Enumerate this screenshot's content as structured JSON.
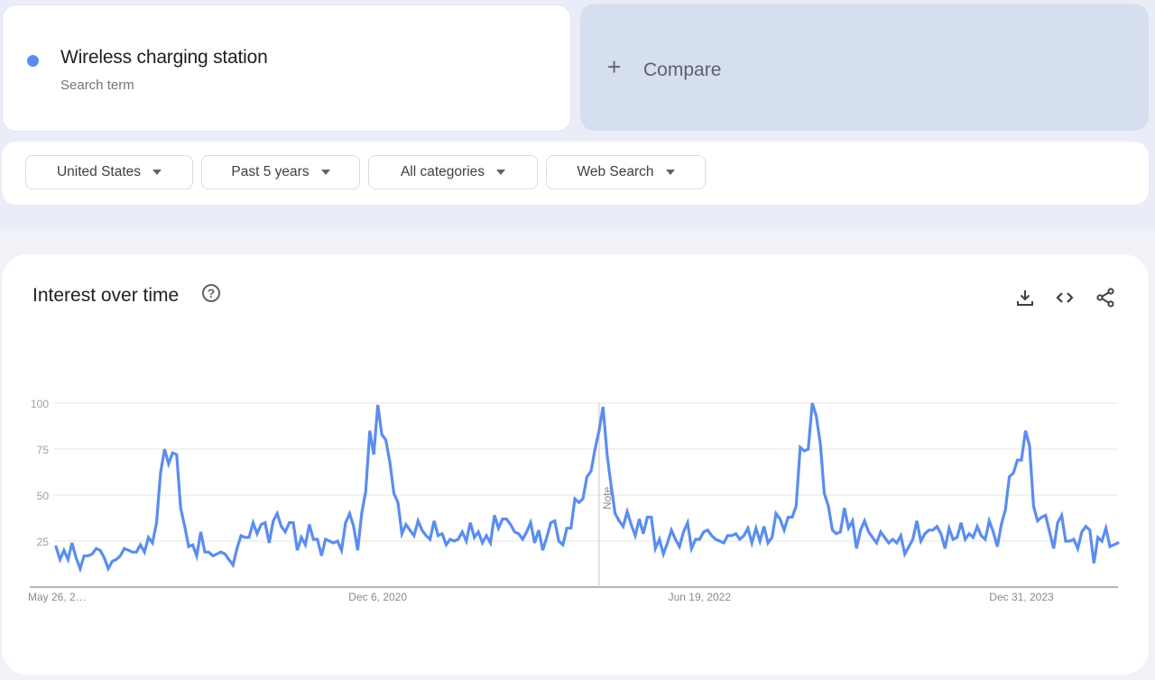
{
  "search_term": {
    "name": "Wireless charging station",
    "subtitle": "Search term",
    "color": "#5b8def"
  },
  "compare": {
    "icon": "plus-icon",
    "label": "Compare"
  },
  "filters": [
    {
      "label": "United States"
    },
    {
      "label": "Past 5 years"
    },
    {
      "label": "All categories"
    },
    {
      "label": "Web Search"
    }
  ],
  "chart_panel": {
    "title": "Interest over time",
    "help_icon": "help-circle-icon",
    "tools": [
      {
        "name": "download-icon",
        "glyph": "download"
      },
      {
        "name": "embed-icon",
        "glyph": "code"
      },
      {
        "name": "share-icon",
        "glyph": "share"
      }
    ],
    "note_label": "Note"
  },
  "chart_data": {
    "type": "line",
    "title": "Interest over time",
    "xlabel": "",
    "ylabel": "",
    "ylim": [
      0,
      100
    ],
    "yticks": [
      25,
      50,
      75,
      100
    ],
    "grid": true,
    "legend": "none",
    "x_tick_labels": [
      {
        "label": "May 26, 2…",
        "index": 0
      },
      {
        "label": "Dec 6, 2020",
        "index": 80
      },
      {
        "label": "Jun 19, 2022",
        "index": 160
      },
      {
        "label": "Dec 31, 2023",
        "index": 240
      }
    ],
    "note_index": 135,
    "series": [
      {
        "name": "Wireless charging station",
        "color": "#5b8def",
        "values": [
          22,
          15,
          20,
          15,
          24,
          16,
          10,
          17,
          17,
          18,
          21,
          20,
          16,
          10,
          14,
          15,
          17,
          21,
          20,
          19,
          19,
          23,
          19,
          27,
          24,
          35,
          62,
          75,
          67,
          73,
          72,
          43,
          33,
          22,
          23,
          17,
          30,
          19,
          19,
          17,
          18,
          19,
          18,
          15,
          12,
          21,
          28,
          27,
          27,
          35,
          29,
          34,
          35,
          24,
          36,
          40,
          33,
          30,
          35,
          35,
          20,
          27,
          23,
          34,
          26,
          26,
          17,
          26,
          25,
          24,
          25,
          20,
          35,
          40,
          33,
          20,
          40,
          52,
          85,
          72,
          99,
          83,
          80,
          68,
          51,
          46,
          29,
          34,
          31,
          28,
          36,
          31,
          28,
          26,
          36,
          28,
          29,
          23,
          26,
          25,
          26,
          30,
          25,
          35,
          27,
          30,
          24,
          28,
          24,
          39,
          32,
          37,
          37,
          34,
          30,
          29,
          26,
          30,
          35,
          24,
          31,
          20,
          27,
          35,
          36,
          25,
          23,
          32,
          32,
          48,
          46,
          48,
          60,
          63,
          75,
          85,
          98,
          72,
          55,
          40,
          36,
          33,
          41,
          34,
          28,
          37,
          29,
          38,
          38,
          21,
          26,
          18,
          24,
          31,
          26,
          22,
          30,
          35,
          21,
          26,
          26,
          30,
          31,
          28,
          26,
          25,
          24,
          28,
          28,
          29,
          26,
          28,
          32,
          24,
          32,
          25,
          33,
          24,
          27,
          40,
          37,
          31,
          38,
          38,
          44,
          76,
          74,
          75,
          100,
          93,
          78,
          51,
          44,
          31,
          29,
          30,
          43,
          32,
          36,
          21,
          31,
          36,
          30,
          27,
          24,
          30,
          27,
          24,
          26,
          24,
          28,
          18,
          22,
          26,
          36,
          25,
          29,
          31,
          31,
          33,
          29,
          21,
          32,
          26,
          27,
          35,
          26,
          29,
          27,
          33,
          28,
          26,
          36,
          30,
          22,
          34,
          42,
          60,
          62,
          69,
          69,
          85,
          77,
          44,
          36,
          38,
          39,
          30,
          21,
          35,
          39,
          25,
          25,
          26,
          21,
          30,
          33,
          31,
          13,
          27,
          25,
          32,
          22,
          23,
          24
        ]
      }
    ]
  }
}
